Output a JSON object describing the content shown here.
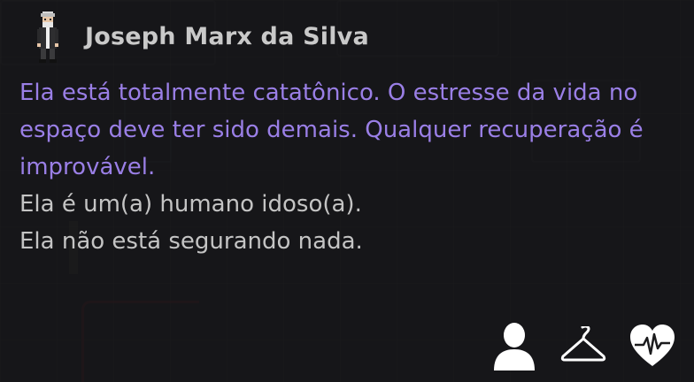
{
  "examine": {
    "character_name": "Joseph Marx da Silva",
    "status_line": "Ela está totalmente catatônico. O estresse da vida no espaço deve ter sido demais. Qualquer recuperação é improvável.",
    "description_lines": [
      "Ela é um(a) humano idoso(a).",
      "Ela não está segurando nada."
    ]
  },
  "actions": [
    {
      "icon": "person-icon"
    },
    {
      "icon": "hanger-icon"
    },
    {
      "icon": "heart-monitor-icon"
    }
  ],
  "colors": {
    "status_text": "#9a7fe6",
    "description_text": "#c4c4c4",
    "name_text": "#c9c9c9",
    "icon_color": "#ffffff"
  }
}
